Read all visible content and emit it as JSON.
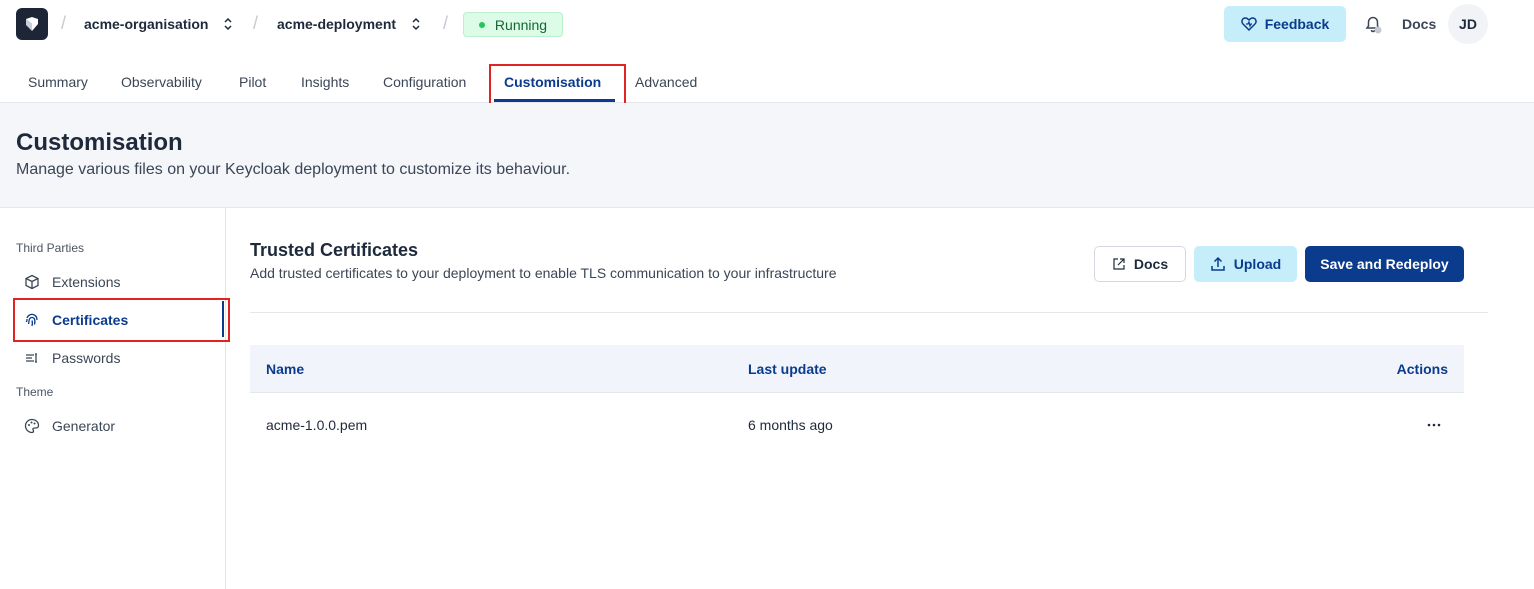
{
  "topbar": {
    "organisation": "acme-organisation",
    "deployment": "acme-deployment",
    "status": "Running",
    "feedback_label": "Feedback",
    "docs_label": "Docs",
    "avatar_initials": "JD"
  },
  "tabs": [
    {
      "label": "Summary"
    },
    {
      "label": "Observability"
    },
    {
      "label": "Pilot"
    },
    {
      "label": "Insights"
    },
    {
      "label": "Configuration"
    },
    {
      "label": "Customisation",
      "active": true
    },
    {
      "label": "Advanced"
    }
  ],
  "header": {
    "title": "Customisation",
    "subtitle": "Manage various files on your Keycloak deployment to customize its behaviour."
  },
  "sidebar": {
    "sections": [
      {
        "label": "Third Parties"
      },
      {
        "label": "Theme"
      }
    ],
    "items": [
      {
        "label": "Extensions",
        "icon": "cube-icon"
      },
      {
        "label": "Certificates",
        "icon": "fingerprint-icon",
        "active": true
      },
      {
        "label": "Passwords",
        "icon": "text-cursor-icon"
      },
      {
        "label": "Generator",
        "icon": "palette-icon"
      }
    ]
  },
  "content": {
    "title": "Trusted Certificates",
    "subtitle": "Add trusted certificates to your deployment to enable TLS communication to your infrastructure",
    "docs_label": "Docs",
    "upload_label": "Upload",
    "save_label": "Save and Redeploy"
  },
  "table": {
    "headers": [
      "Name",
      "Last update",
      "Actions"
    ],
    "rows": [
      {
        "name": "acme-1.0.0.pem",
        "last_update": "6 months ago"
      }
    ]
  },
  "colors": {
    "primary": "#0b3b8c",
    "accent_light": "#c5eefa",
    "status_bg": "#dcfce7",
    "highlight": "#e02424"
  }
}
